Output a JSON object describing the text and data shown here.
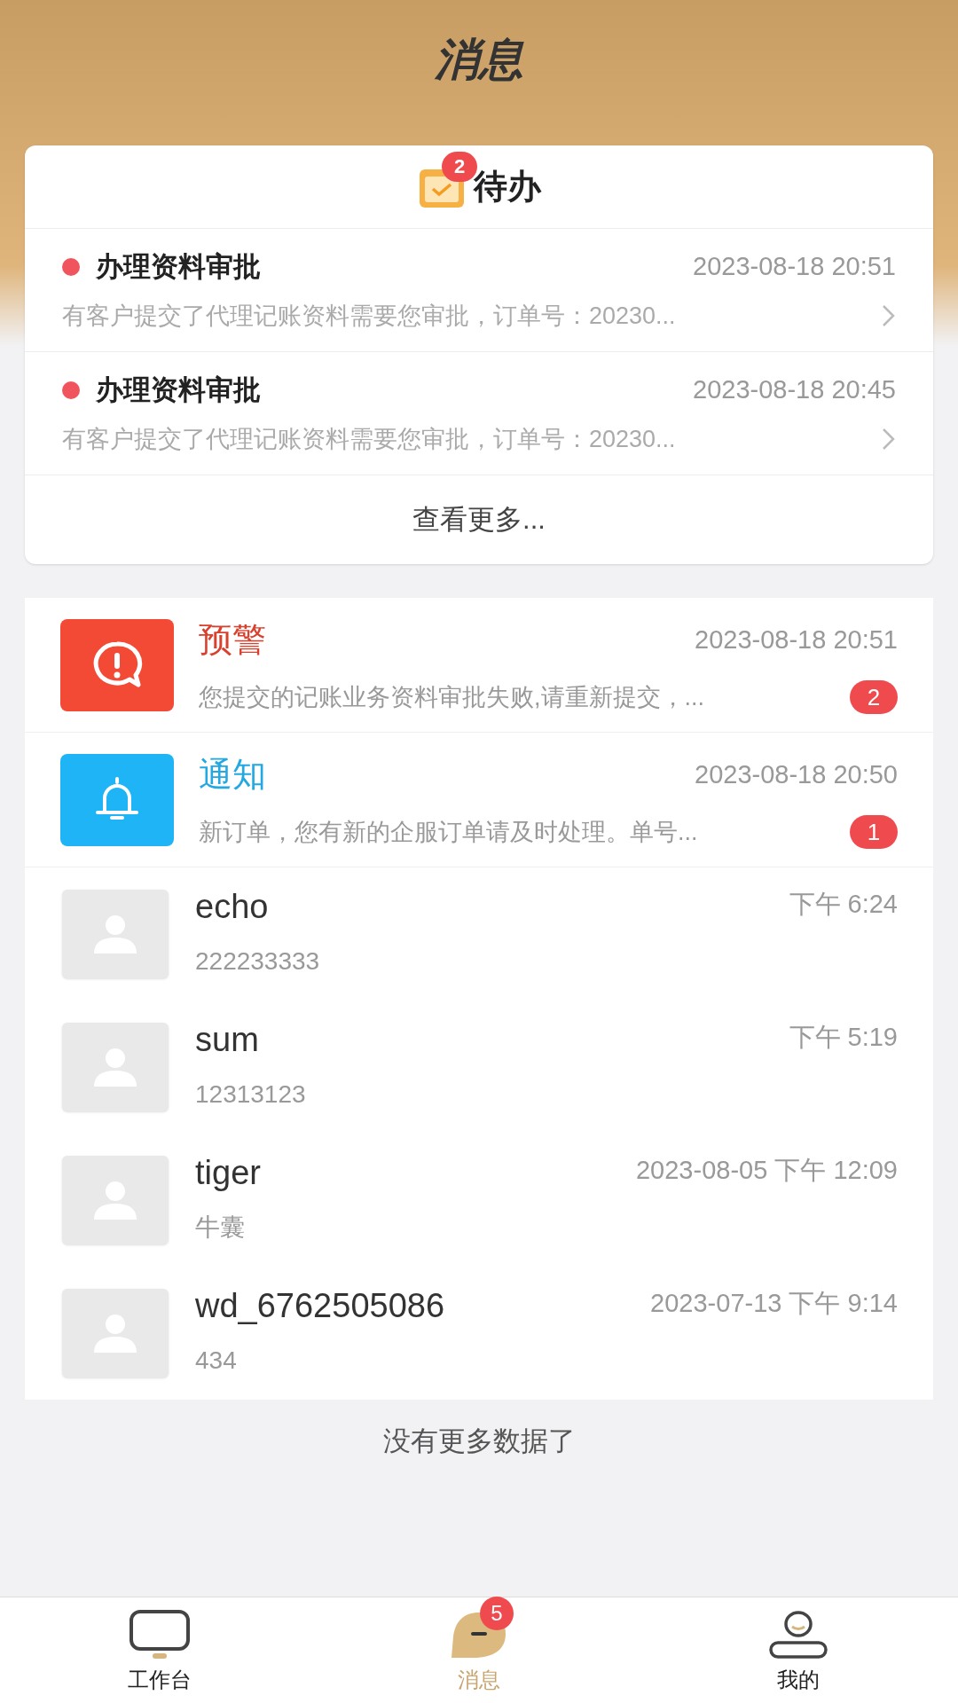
{
  "header": {
    "title": "消息"
  },
  "todo": {
    "title": "待办",
    "badge": "2",
    "items": [
      {
        "title": "办理资料审批",
        "time": "2023-08-18 20:51",
        "summary": "有客户提交了代理记账资料需要您审批，订单号：20230...",
        "unread": true
      },
      {
        "title": "办理资料审批",
        "time": "2023-08-18 20:45",
        "summary": "有客户提交了代理记账资料需要您审批，订单号：20230...",
        "unread": true
      }
    ],
    "more": "查看更多..."
  },
  "channels": [
    {
      "kind": "warning",
      "name": "预警",
      "time": "2023-08-18 20:51",
      "summary": "您提交的记账业务资料审批失败,请重新提交，...",
      "badge": "2"
    },
    {
      "kind": "notice",
      "name": "通知",
      "time": "2023-08-18 20:50",
      "summary": "新订单，您有新的企服订单请及时处理。单号...",
      "badge": "1"
    }
  ],
  "chats": [
    {
      "name": "echo",
      "message": "222233333",
      "time": "下午 6:24"
    },
    {
      "name": "sum",
      "message": "12313123",
      "time": "下午 5:19"
    },
    {
      "name": "tiger",
      "message": "牛囊",
      "time": "2023-08-05 下午 12:09"
    },
    {
      "name": "wd_6762505086",
      "message": "434",
      "time": "2023-07-13 下午 9:14"
    }
  ],
  "end_text": "没有更多数据了",
  "tabs": [
    {
      "kind": "workbench",
      "label": "工作台",
      "selected": false
    },
    {
      "kind": "messages",
      "label": "消息",
      "selected": true,
      "badge": "5"
    },
    {
      "kind": "profile",
      "label": "我的",
      "selected": false
    }
  ]
}
